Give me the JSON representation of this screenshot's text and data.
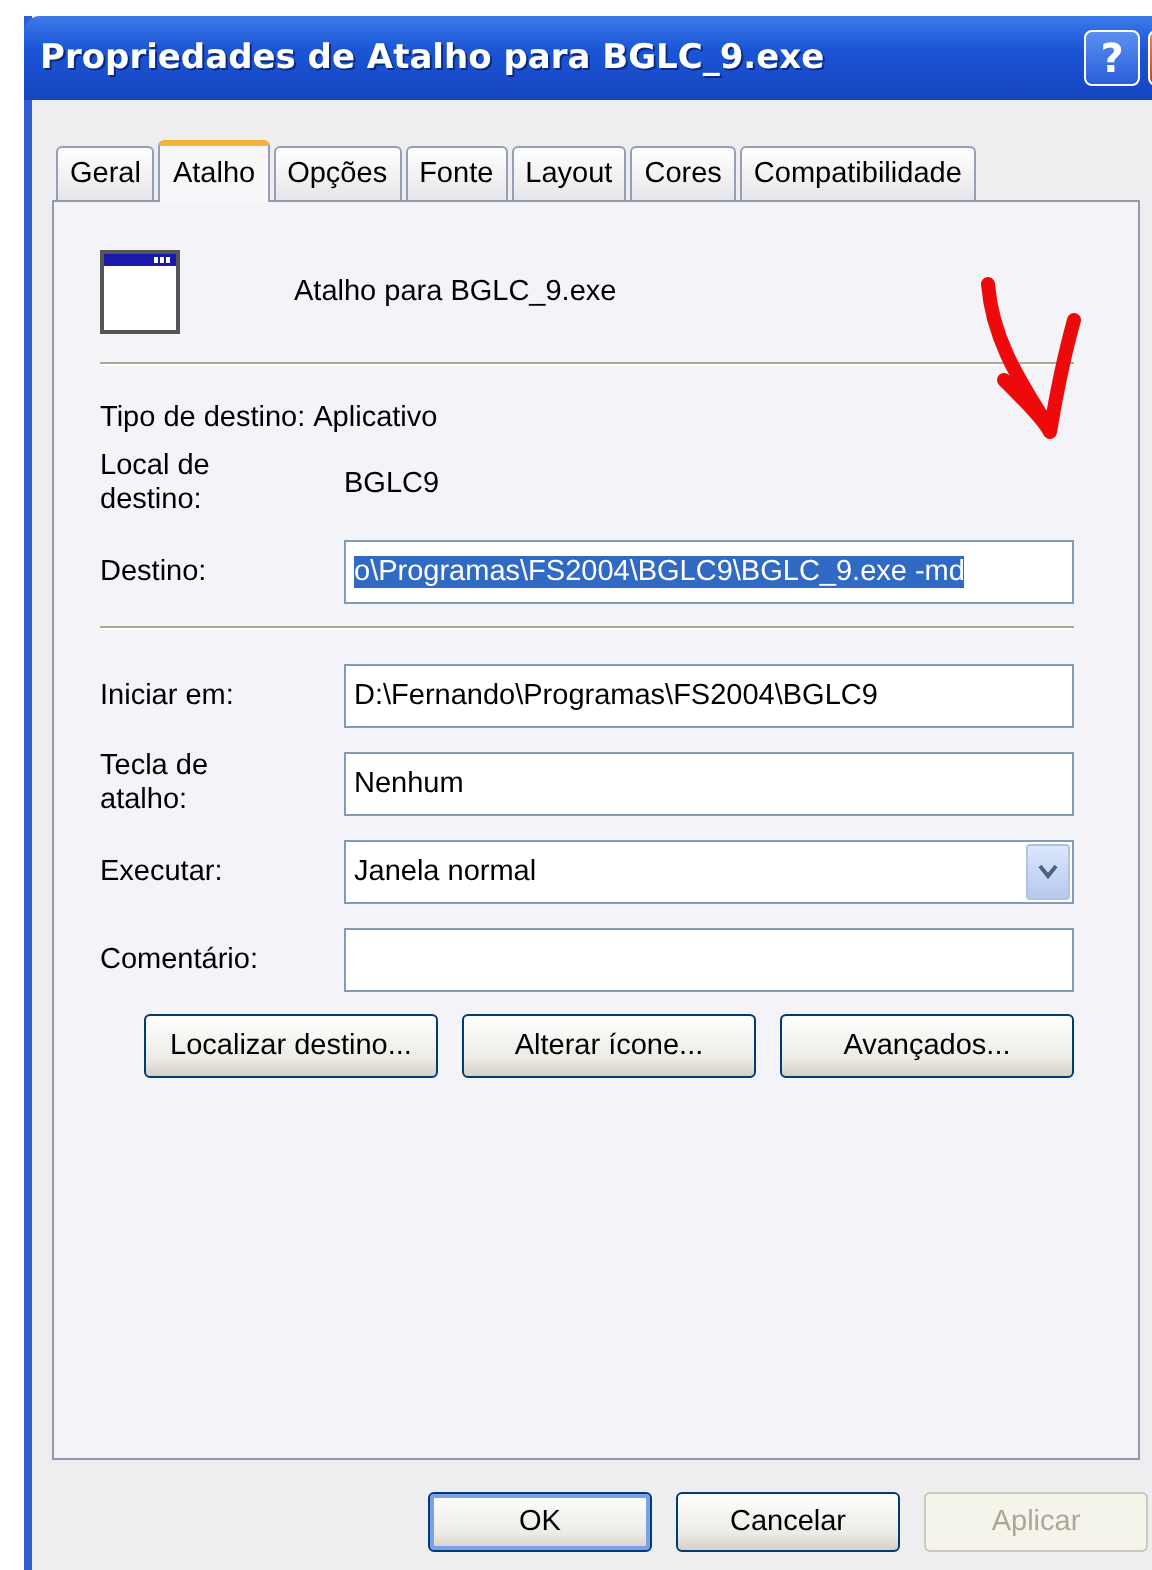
{
  "window": {
    "title": "Propriedades de Atalho para BGLC_9.exe",
    "title_buttons": [
      {
        "kind": "help",
        "label": "?"
      },
      {
        "kind": "close"
      }
    ]
  },
  "tabs": [
    {
      "label": "Geral",
      "selected": false
    },
    {
      "label": "Atalho",
      "selected": true
    },
    {
      "label": "Opções",
      "selected": false
    },
    {
      "label": "Fonte",
      "selected": false
    },
    {
      "label": "Layout",
      "selected": false
    },
    {
      "label": "Cores",
      "selected": false
    },
    {
      "label": "Compatibilidade",
      "selected": false
    }
  ],
  "header": {
    "name": "Atalho para BGLC_9.exe"
  },
  "info": [
    {
      "label": "Tipo de destino:",
      "value": "Aplicativo",
      "kind": "inline"
    },
    {
      "label": "Local de destino:",
      "value": "BGLC9",
      "kind": "column"
    }
  ],
  "fields": [
    {
      "label": "Destino:",
      "value": "o\\Programas\\FS2004\\BGLC9\\BGLC_9.exe -md",
      "kind": "text",
      "highlighted": true,
      "separator_after": true
    },
    {
      "label": "Iniciar em:",
      "value": "D:\\Fernando\\Programas\\FS2004\\BGLC9",
      "kind": "text"
    },
    {
      "label": "Tecla de atalho:",
      "value": "Nenhum",
      "kind": "text"
    },
    {
      "label": "Executar:",
      "value": "Janela normal",
      "kind": "dropdown"
    },
    {
      "label": "Comentário:",
      "kind": "text"
    }
  ],
  "actions": [
    {
      "label": "Localizar destino..."
    },
    {
      "label": "Alterar ícone..."
    },
    {
      "label": "Avançados..."
    }
  ],
  "footer_buttons": [
    {
      "label": "OK",
      "disabled": false,
      "default": true
    },
    {
      "label": "Cancelar",
      "disabled": false,
      "default": false
    },
    {
      "label": "Aplicar",
      "disabled": true,
      "default": false
    }
  ],
  "annotation": {
    "kind": "arrow"
  }
}
